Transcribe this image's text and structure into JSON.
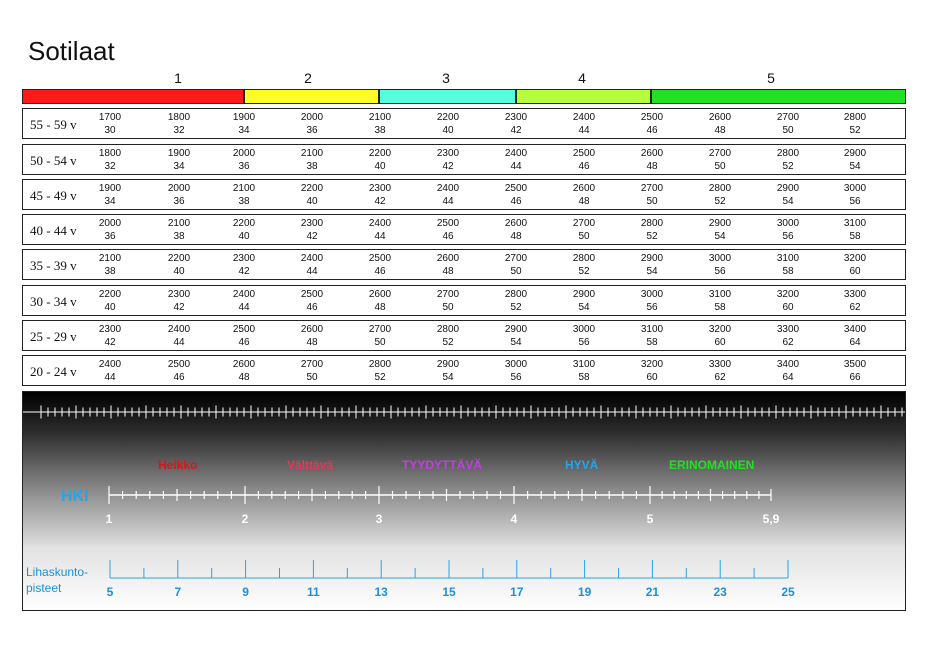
{
  "title": "Sotilaat",
  "levels": [
    "1",
    "2",
    "3",
    "4",
    "5"
  ],
  "bands": [
    {
      "level": "1",
      "color": "#ff1a1a"
    },
    {
      "level": "2",
      "color": "#ffff22"
    },
    {
      "level": "3",
      "color": "#55ffdd"
    },
    {
      "level": "4",
      "color": "#b4ff3a"
    },
    {
      "level": "5",
      "color": "#22e022"
    }
  ],
  "rows": [
    {
      "age": "55 - 59 v",
      "cells": [
        [
          "1700",
          "30"
        ],
        [
          "1800",
          "32"
        ],
        [
          "1900",
          "34"
        ],
        [
          "2000",
          "36"
        ],
        [
          "2100",
          "38"
        ],
        [
          "2200",
          "40"
        ],
        [
          "2300",
          "42"
        ],
        [
          "2400",
          "44"
        ],
        [
          "2500",
          "46"
        ],
        [
          "2600",
          "48"
        ],
        [
          "2700",
          "50"
        ],
        [
          "2800",
          "52"
        ]
      ]
    },
    {
      "age": "50 - 54 v",
      "cells": [
        [
          "1800",
          "32"
        ],
        [
          "1900",
          "34"
        ],
        [
          "2000",
          "36"
        ],
        [
          "2100",
          "38"
        ],
        [
          "2200",
          "40"
        ],
        [
          "2300",
          "42"
        ],
        [
          "2400",
          "44"
        ],
        [
          "2500",
          "46"
        ],
        [
          "2600",
          "48"
        ],
        [
          "2700",
          "50"
        ],
        [
          "2800",
          "52"
        ],
        [
          "2900",
          "54"
        ]
      ]
    },
    {
      "age": "45 - 49 v",
      "cells": [
        [
          "1900",
          "34"
        ],
        [
          "2000",
          "36"
        ],
        [
          "2100",
          "38"
        ],
        [
          "2200",
          "40"
        ],
        [
          "2300",
          "42"
        ],
        [
          "2400",
          "44"
        ],
        [
          "2500",
          "46"
        ],
        [
          "2600",
          "48"
        ],
        [
          "2700",
          "50"
        ],
        [
          "2800",
          "52"
        ],
        [
          "2900",
          "54"
        ],
        [
          "3000",
          "56"
        ]
      ]
    },
    {
      "age": "40 - 44 v",
      "cells": [
        [
          "2000",
          "36"
        ],
        [
          "2100",
          "38"
        ],
        [
          "2200",
          "40"
        ],
        [
          "2300",
          "42"
        ],
        [
          "2400",
          "44"
        ],
        [
          "2500",
          "46"
        ],
        [
          "2600",
          "48"
        ],
        [
          "2700",
          "50"
        ],
        [
          "2800",
          "52"
        ],
        [
          "2900",
          "54"
        ],
        [
          "3000",
          "56"
        ],
        [
          "3100",
          "58"
        ]
      ]
    },
    {
      "age": "35 - 39 v",
      "cells": [
        [
          "2100",
          "38"
        ],
        [
          "2200",
          "40"
        ],
        [
          "2300",
          "42"
        ],
        [
          "2400",
          "44"
        ],
        [
          "2500",
          "46"
        ],
        [
          "2600",
          "48"
        ],
        [
          "2700",
          "50"
        ],
        [
          "2800",
          "52"
        ],
        [
          "2900",
          "54"
        ],
        [
          "3000",
          "56"
        ],
        [
          "3100",
          "58"
        ],
        [
          "3200",
          "60"
        ]
      ]
    },
    {
      "age": "30 - 34 v",
      "cells": [
        [
          "2200",
          "40"
        ],
        [
          "2300",
          "42"
        ],
        [
          "2400",
          "44"
        ],
        [
          "2500",
          "46"
        ],
        [
          "2600",
          "48"
        ],
        [
          "2700",
          "50"
        ],
        [
          "2800",
          "52"
        ],
        [
          "2900",
          "54"
        ],
        [
          "3000",
          "56"
        ],
        [
          "3100",
          "58"
        ],
        [
          "3200",
          "60"
        ],
        [
          "3300",
          "62"
        ]
      ]
    },
    {
      "age": "25 - 29 v",
      "cells": [
        [
          "2300",
          "42"
        ],
        [
          "2400",
          "44"
        ],
        [
          "2500",
          "46"
        ],
        [
          "2600",
          "48"
        ],
        [
          "2700",
          "50"
        ],
        [
          "2800",
          "52"
        ],
        [
          "2900",
          "54"
        ],
        [
          "3000",
          "56"
        ],
        [
          "3100",
          "58"
        ],
        [
          "3200",
          "60"
        ],
        [
          "3300",
          "62"
        ],
        [
          "3400",
          "64"
        ]
      ]
    },
    {
      "age": "20 - 24 v",
      "cells": [
        [
          "2400",
          "44"
        ],
        [
          "2500",
          "46"
        ],
        [
          "2600",
          "48"
        ],
        [
          "2700",
          "50"
        ],
        [
          "2800",
          "52"
        ],
        [
          "2900",
          "54"
        ],
        [
          "3000",
          "56"
        ],
        [
          "3100",
          "58"
        ],
        [
          "3200",
          "60"
        ],
        [
          "3300",
          "62"
        ],
        [
          "3400",
          "64"
        ],
        [
          "3500",
          "66"
        ]
      ]
    }
  ],
  "ratings": [
    {
      "label": "Heikko",
      "color": "#d91616"
    },
    {
      "label": "Välttävä",
      "color": "#e8365a"
    },
    {
      "label": "TYYDYTTÄVÄ",
      "color": "#c23ee0"
    },
    {
      "label": "HYVÄ",
      "color": "#29a3e8"
    },
    {
      "label": "ERINOMAINEN",
      "color": "#22e022"
    }
  ],
  "hki": {
    "label": "HKI",
    "numbers": [
      "1",
      "2",
      "3",
      "4",
      "5",
      "5,9"
    ]
  },
  "lihaskunto": {
    "label_line1": "Lihaskunto-",
    "label_line2": "pisteet",
    "numbers": [
      "5",
      "7",
      "9",
      "11",
      "13",
      "15",
      "17",
      "19",
      "21",
      "23",
      "25"
    ]
  }
}
